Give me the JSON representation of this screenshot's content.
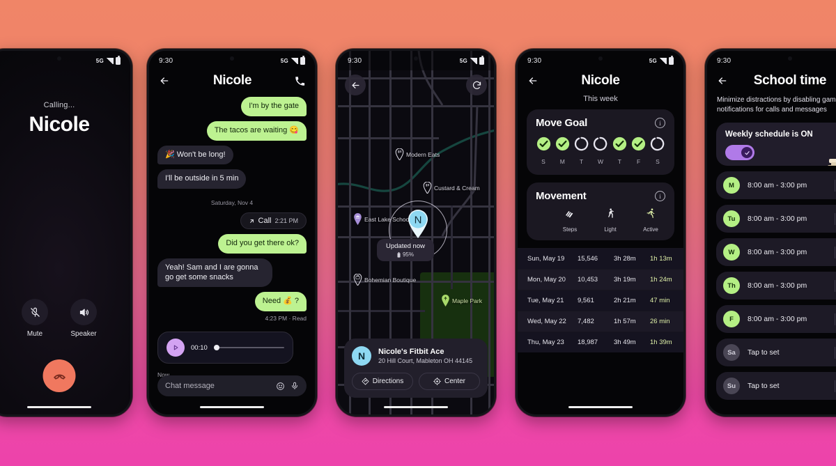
{
  "theme": {
    "bg_top": "#f08567",
    "bg_bottom": "#ed42ab",
    "accent_green": "#bdf291",
    "accent_purple": "#d3a3f2",
    "accent_coral": "#f0785f",
    "accent_blue": "#8ed8f2"
  },
  "phone1": {
    "name": "call-screen",
    "statusbar": {
      "time": "",
      "network": "5G"
    },
    "calling_label": "Calling...",
    "contact_name": "Nicole",
    "controls": [
      {
        "icon": "mic-off-icon",
        "label": "Mute"
      },
      {
        "icon": "speaker-icon",
        "label": "Speaker"
      }
    ],
    "hangup": {
      "icon": "end-call-icon",
      "label": "End call"
    }
  },
  "phone2": {
    "name": "chat-screen",
    "statusbar": {
      "time": "9:30",
      "network": "5G"
    },
    "appbar": {
      "back": "back-arrow-icon",
      "title": "Nicole",
      "call": "phone-icon"
    },
    "messages": [
      {
        "dir": "out",
        "text": "I'm by the gate"
      },
      {
        "dir": "out",
        "text": "The tacos are waiting 😋"
      },
      {
        "dir": "in",
        "text": "🎉 Won't be long!"
      },
      {
        "dir": "in",
        "text": "I'll be outside in 5 min"
      }
    ],
    "day_separator": "Saturday, Nov 4",
    "call_chip": {
      "label": "Call",
      "time": "2:21 PM"
    },
    "messages2": [
      {
        "dir": "out",
        "text": "Did you get there ok?"
      },
      {
        "dir": "in",
        "text": "Yeah! Sam and I are gonna go get some snacks"
      },
      {
        "dir": "out",
        "text": "Need 💰 ?"
      }
    ],
    "receipt": "4:23 PM · Read",
    "voice_note": {
      "duration": "00:10",
      "timestamp": "Now"
    },
    "composer": {
      "placeholder": "Chat message",
      "emoji": "emoji-icon",
      "mic": "mic-icon"
    }
  },
  "phone3": {
    "name": "map-screen",
    "statusbar": {
      "time": "9:30",
      "network": "5G"
    },
    "buttons": {
      "back": "back-arrow-icon",
      "refresh": "refresh-icon"
    },
    "pois": [
      {
        "label": "Modern Eats",
        "type": "restaurant"
      },
      {
        "label": "Custard & Cream",
        "type": "restaurant"
      },
      {
        "label": "East Lake School",
        "type": "school"
      },
      {
        "label": "Bohemian Boutique",
        "type": "store"
      },
      {
        "label": "Maple Park",
        "type": "park"
      }
    ],
    "marker": {
      "initial": "N"
    },
    "status_badge": {
      "updated": "Updated now",
      "battery": "95%"
    },
    "sheet": {
      "initial": "N",
      "device": "Nicole's Fitbit Ace",
      "address": "20 Hill Court, Mableton OH 44145",
      "buttons": [
        {
          "icon": "directions-icon",
          "label": "Directions"
        },
        {
          "icon": "center-icon",
          "label": "Center"
        }
      ]
    }
  },
  "phone4": {
    "name": "activity-screen",
    "statusbar": {
      "time": "9:30",
      "network": "5G"
    },
    "appbar": {
      "back": "back-arrow-icon",
      "title": "Nicole"
    },
    "subheader": "This week",
    "move_goal": {
      "title": "Move Goal",
      "info": "info-icon",
      "days": [
        {
          "label": "S",
          "complete": true
        },
        {
          "label": "M",
          "complete": true
        },
        {
          "label": "T",
          "complete": false
        },
        {
          "label": "W",
          "complete": false
        },
        {
          "label": "T",
          "complete": true
        },
        {
          "label": "F",
          "complete": true
        },
        {
          "label": "S",
          "complete": false
        }
      ]
    },
    "movement": {
      "title": "Movement",
      "info": "info-icon",
      "columns": [
        {
          "icon": "shoe-icon",
          "label": "Steps"
        },
        {
          "icon": "walk-icon",
          "label": "Light"
        },
        {
          "icon": "run-icon",
          "label": "Active"
        }
      ],
      "rows": [
        {
          "date": "Sun, May 19",
          "steps": "15,546",
          "light": "3h 28m",
          "active": "1h 13m"
        },
        {
          "date": "Mon, May 20",
          "steps": "10,453",
          "light": "3h 19m",
          "active": "1h 24m"
        },
        {
          "date": "Tue, May 21",
          "steps": "9,561",
          "light": "2h 21m",
          "active": "47 min"
        },
        {
          "date": "Wed, May 22",
          "steps": "7,482",
          "light": "1h 57m",
          "active": "26 min"
        },
        {
          "date": "Thu, May 23",
          "steps": "18,987",
          "light": "3h 49m",
          "active": "1h 39m"
        }
      ]
    }
  },
  "phone5": {
    "name": "school-time-screen",
    "statusbar": {
      "time": "9:30",
      "network": "5G"
    },
    "appbar": {
      "back": "back-arrow-icon",
      "title": "School time"
    },
    "description": "Minimize distractions by disabling games and notifications for calls and messages",
    "schedule_card": {
      "title": "Weekly schedule is ON",
      "toggle_state": "on",
      "illustration": "student-illustration"
    },
    "days": [
      {
        "abbr": "M",
        "time": "8:00 am - 3:00 pm",
        "active": true
      },
      {
        "abbr": "Tu",
        "time": "8:00 am - 3:00 pm",
        "active": true
      },
      {
        "abbr": "W",
        "time": "8:00 am - 3:00 pm",
        "active": true
      },
      {
        "abbr": "Th",
        "time": "8:00 am - 3:00 pm",
        "active": true
      },
      {
        "abbr": "F",
        "time": "8:00 am - 3:00 pm",
        "active": true
      },
      {
        "abbr": "Sa",
        "time": "Tap to set",
        "active": false
      },
      {
        "abbr": "Su",
        "time": "Tap to set",
        "active": false
      }
    ]
  }
}
